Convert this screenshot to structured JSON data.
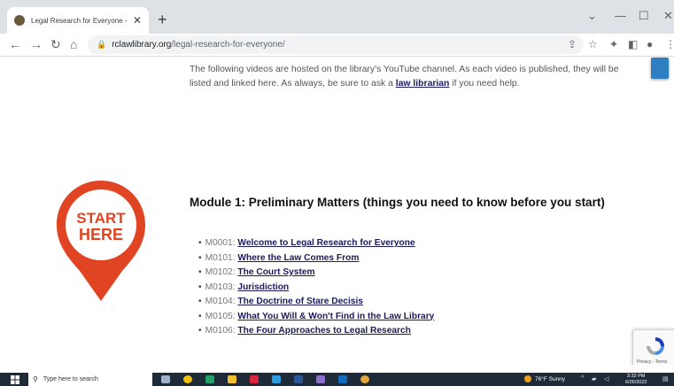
{
  "browser": {
    "tab_title": "Legal Research for Everyone - Riverside Co",
    "tab_close": "✕",
    "new_tab": "+",
    "url_domain": "rclawlibrary.org",
    "url_path": "/legal-research-for-everyone/"
  },
  "page": {
    "intro_text": "The following videos are hosted on the library's YouTube channel. As each video is published, they will be listed and linked here. As always, be sure to ask a ",
    "intro_link": "law librarian",
    "intro_end": " if you need help.",
    "pin_line1": "START",
    "pin_line2": "HERE",
    "module_title": "Module 1: Preliminary Matters (things you need to know before you start)",
    "videos": [
      {
        "code": "M0001:",
        "title": "Welcome to Legal Research for Everyone"
      },
      {
        "code": "M0101:",
        "title": "Where the Law Comes From"
      },
      {
        "code": "M0102:",
        "title": "The Court System"
      },
      {
        "code": "M0103:",
        "title": "Jurisdiction"
      },
      {
        "code": "M0104:",
        "title": "The Doctrine of Stare Decisis"
      },
      {
        "code": "M0105:",
        "title": "What You Will & Won't Find in the Law Library"
      },
      {
        "code": "M0106:",
        "title": "The Four Approaches to Legal Research"
      }
    ],
    "recaptcha_text": "Privacy - Terms"
  },
  "taskbar": {
    "search_placeholder": "Type here to search",
    "weather": "76°F  Sunny",
    "clock_time": "3:32 PM",
    "clock_date": "6/26/2022"
  },
  "colors": {
    "pin_red": "#e04422",
    "link": "#1a1a5e"
  }
}
